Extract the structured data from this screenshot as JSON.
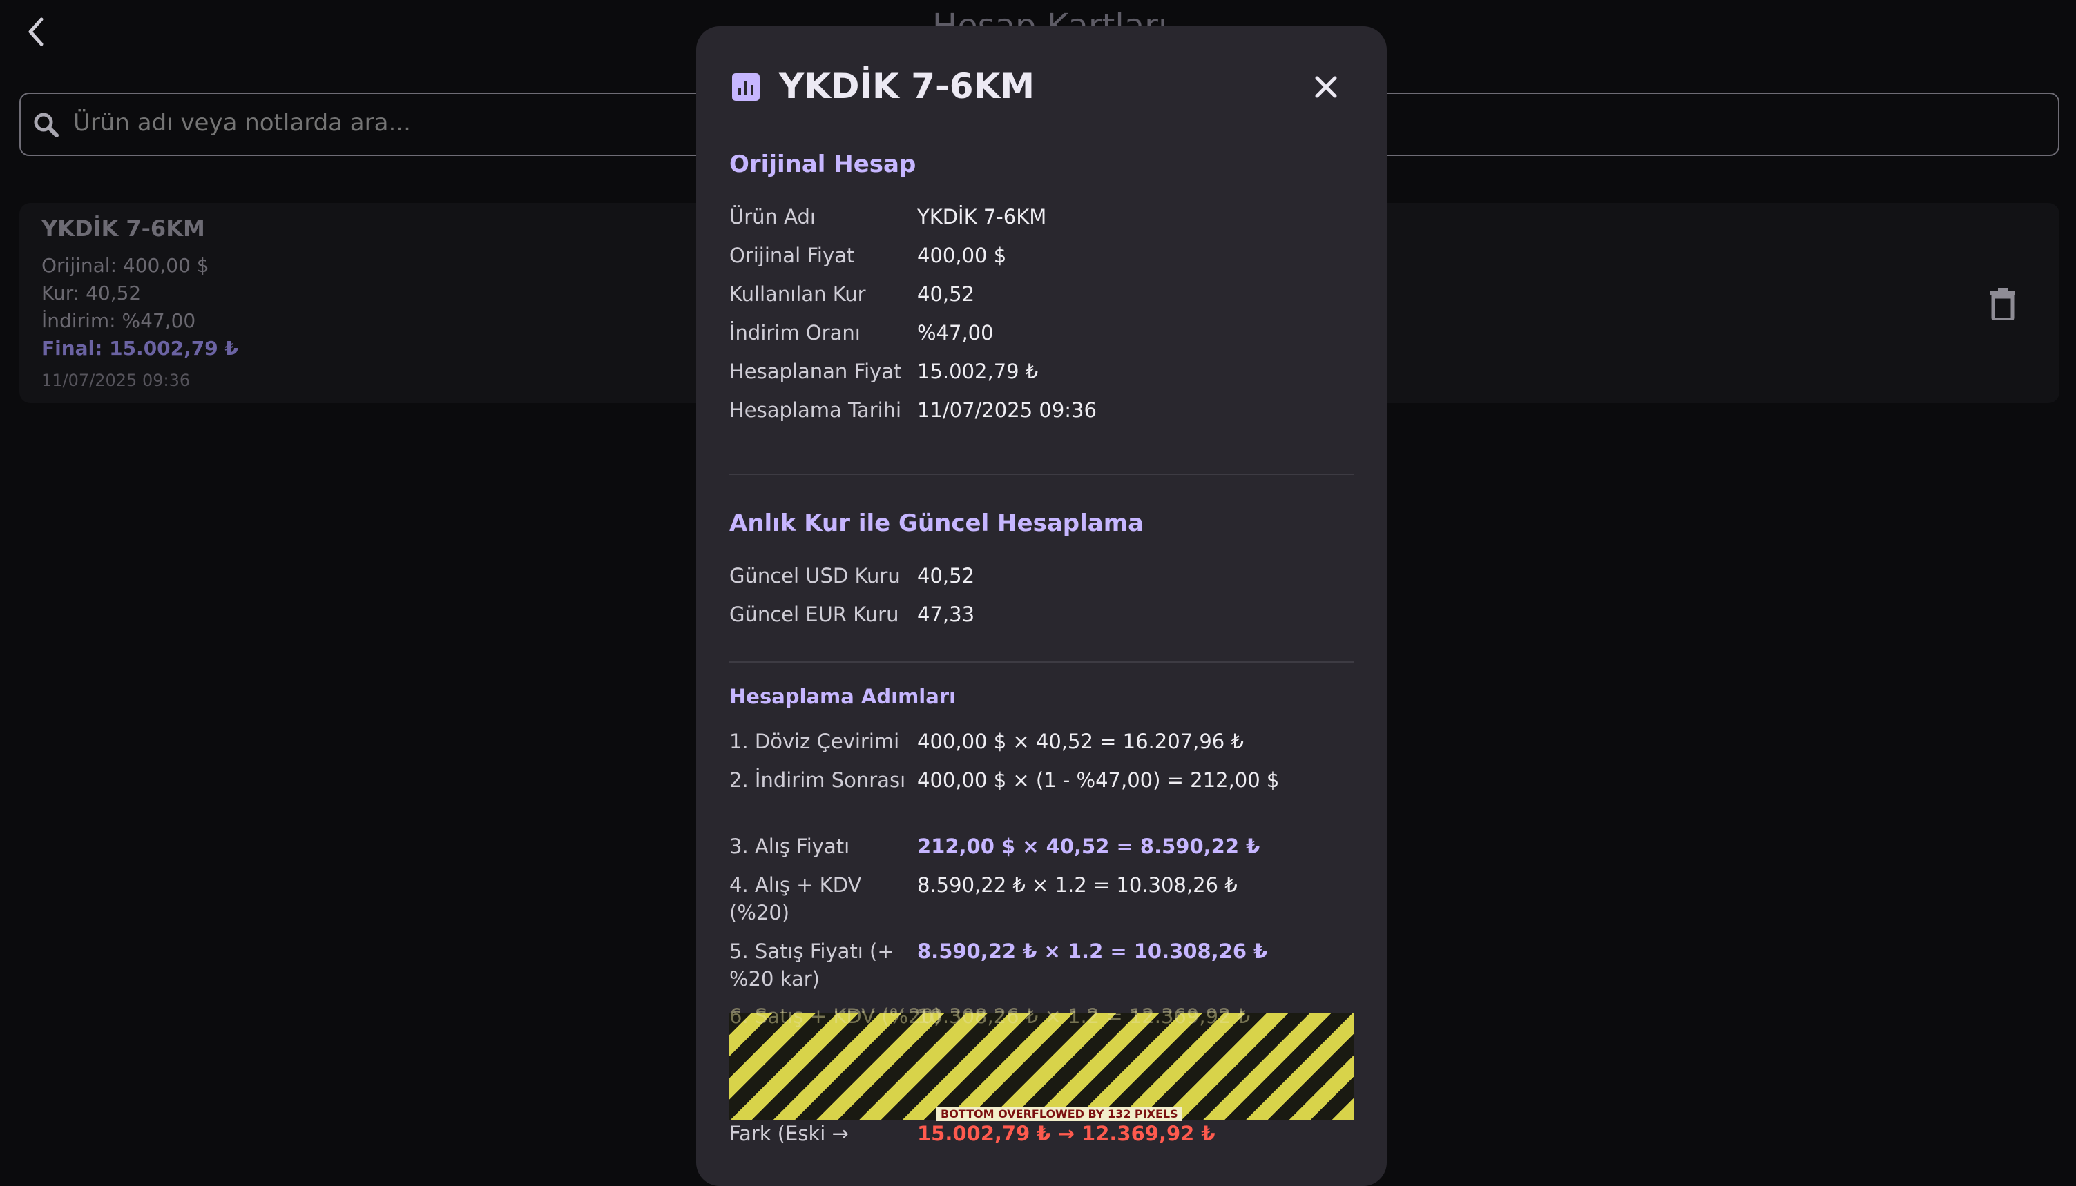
{
  "background": {
    "title": "Hesap Kartları",
    "search_placeholder": "Ürün adı veya notlarda ara...",
    "card": {
      "title": "YKDİK 7-6KM",
      "original": "Orijinal: 400,00 $",
      "rate": "Kur: 40,52",
      "discount": "İndirim: %47,00",
      "final": "Final: 15.002,79 ₺",
      "date": "11/07/2025 09:36"
    }
  },
  "dialog": {
    "title": "YKDİK 7-6KM",
    "icon": "chart-icon",
    "close_icon": "close-icon",
    "original": {
      "heading": "Orijinal Hesap",
      "rows": [
        {
          "label": "Ürün Adı",
          "value": "YKDİK 7-6KM"
        },
        {
          "label": "Orijinal Fiyat",
          "value": "400,00 $"
        },
        {
          "label": "Kullanılan Kur",
          "value": "40,52"
        },
        {
          "label": "İndirim Oranı",
          "value": "%47,00"
        },
        {
          "label": "Hesaplanan Fiyat",
          "value": "15.002,79 ₺"
        },
        {
          "label": "Hesaplama Tarihi",
          "value": "11/07/2025 09:36"
        }
      ]
    },
    "current": {
      "heading": "Anlık Kur ile Güncel Hesaplama",
      "rows": [
        {
          "label": "Güncel USD Kuru",
          "value": "40,52"
        },
        {
          "label": "Güncel EUR Kuru",
          "value": "47,33"
        }
      ]
    },
    "steps": {
      "heading": "Hesaplama Adımları",
      "rows": [
        {
          "label": "1. Döviz Çevirimi",
          "value": "400,00 $ × 40,52 = 16.207,96 ₺"
        },
        {
          "label": "2. İndirim Sonrası",
          "value": "400,00 $ × (1 - %47,00) = 212,00 $"
        },
        {
          "label": "3. Alış Fiyatı",
          "value": "212,00 $ × 40,52 = 8.590,22 ₺"
        },
        {
          "label": "4. Alış + KDV (%20)",
          "value": "8.590,22 ₺ × 1.2 = 10.308,26 ₺"
        },
        {
          "label": "5. Satış Fiyatı (+ %20 kar)",
          "value": "8.590,22 ₺ × 1.2 = 10.308,26 ₺"
        },
        {
          "label": "6. Satış + KDV (%20)",
          "value": "10.308,26 ₺ × 1.2 = 12.369,92 ₺"
        },
        {
          "label": "Fark (Eski →",
          "value": "15.002,79 ₺ → 12.369,92 ₺"
        }
      ]
    },
    "overflow_label": "BOTTOM OVERFLOWED BY 132 PIXELS"
  },
  "colors": {
    "accent": "#c6b6ff",
    "danger": "#ff5a4e",
    "dialog_bg": "#29272e",
    "page_bg": "#0b0b0d"
  }
}
